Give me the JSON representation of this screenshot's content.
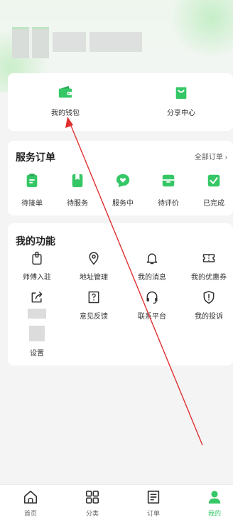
{
  "colors": {
    "accent": "#35c766",
    "arrow": "#e03030"
  },
  "wallet_section": {
    "items": [
      {
        "label": "我的钱包",
        "icon": "wallet-icon"
      },
      {
        "label": "分享中心",
        "icon": "shopping-bag-icon"
      }
    ]
  },
  "orders_section": {
    "title": "服务订单",
    "see_all": "全部订单",
    "items": [
      {
        "label": "待接单",
        "icon": "clipboard-icon"
      },
      {
        "label": "待服务",
        "icon": "bookmark-icon"
      },
      {
        "label": "服务中",
        "icon": "chat-heart-icon"
      },
      {
        "label": "待评价",
        "icon": "inbox-icon"
      },
      {
        "label": "已完成",
        "icon": "check-box-icon"
      }
    ]
  },
  "functions_section": {
    "title": "我的功能",
    "items": [
      {
        "label": "师傅入驻",
        "icon": "badge-icon"
      },
      {
        "label": "地址管理",
        "icon": "location-pin-icon"
      },
      {
        "label": "我的消息",
        "icon": "bell-icon"
      },
      {
        "label": "我的优惠券",
        "icon": "coupon-icon"
      },
      {
        "label": "",
        "icon": "share-icon"
      },
      {
        "label": "意见反馈",
        "icon": "feedback-icon"
      },
      {
        "label": "联系平台",
        "icon": "headset-icon"
      },
      {
        "label": "我的投诉",
        "icon": "shield-alert-icon"
      },
      {
        "label": "设置",
        "icon": "settings-icon"
      }
    ]
  },
  "tabbar": {
    "items": [
      {
        "label": "首页",
        "icon": "home-icon",
        "active": false
      },
      {
        "label": "分类",
        "icon": "grid-icon",
        "active": false
      },
      {
        "label": "订单",
        "icon": "order-list-icon",
        "active": false
      },
      {
        "label": "我的",
        "icon": "user-icon",
        "active": true
      }
    ]
  }
}
